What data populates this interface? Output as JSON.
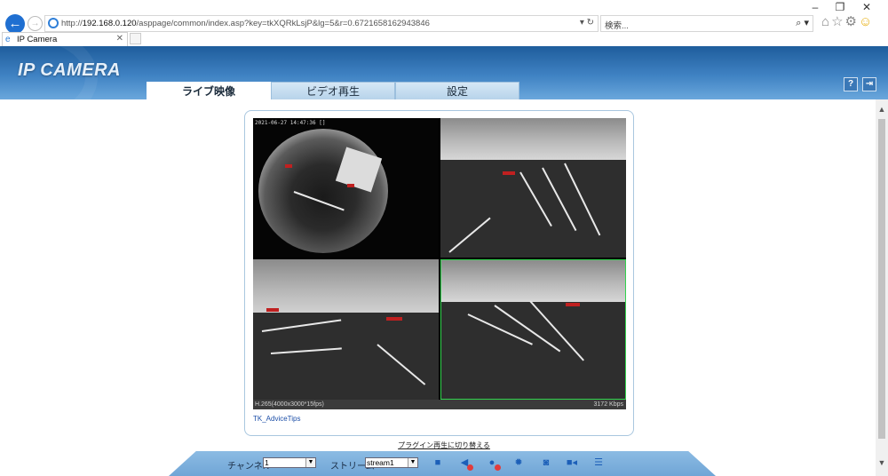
{
  "window": {
    "minimize": "–",
    "maximize": "❐",
    "close": "✕"
  },
  "browser": {
    "url_prefix": "http://",
    "url_host": "192.168.0.120",
    "url_path": "/asppage/common/index.asp?key=tkXQRkLsjP&lg=5&r=0.6721658162943846",
    "addr_tools": "▾ ↻",
    "search_placeholder": "検索...",
    "search_icon": "⌕ ▾",
    "tab_title": "IP Camera",
    "tab_close": "✕",
    "toolbar_icons": [
      "home-icon",
      "star-icon",
      "gear-icon",
      "smiley-icon"
    ]
  },
  "app": {
    "logo": "IP CAMERA",
    "tabs": [
      {
        "label": "ライブ映像",
        "active": true
      },
      {
        "label": "ビデオ再生",
        "active": false
      },
      {
        "label": "設定",
        "active": false
      }
    ],
    "help_icon": "help-icon",
    "logout_icon": "logout-icon"
  },
  "video": {
    "timestamp": "2021-06-27 14:47:36 []",
    "codec_info": "H.265(4000x3000*15fps)",
    "bitrate": "3172 Kbps",
    "advice_link": "TK_AdviceTips",
    "selected_feed": 4
  },
  "plugin_link": "プラグイン再生に切り替える",
  "controls": {
    "channel_label": "チャンネル",
    "channel_value": "1",
    "stream_label": "ストリーム",
    "stream_value": "stream1",
    "icons": [
      "stop-icon",
      "speaker-muted-icon",
      "mic-muted-icon",
      "settings-icon",
      "camera-snapshot-icon",
      "record-video-icon",
      "list-icon"
    ]
  },
  "colors": {
    "accent": "#1f6fd1",
    "header": "#3f82c3",
    "toolbar": "#7fb0dc",
    "selected_border": "#31d34d"
  }
}
